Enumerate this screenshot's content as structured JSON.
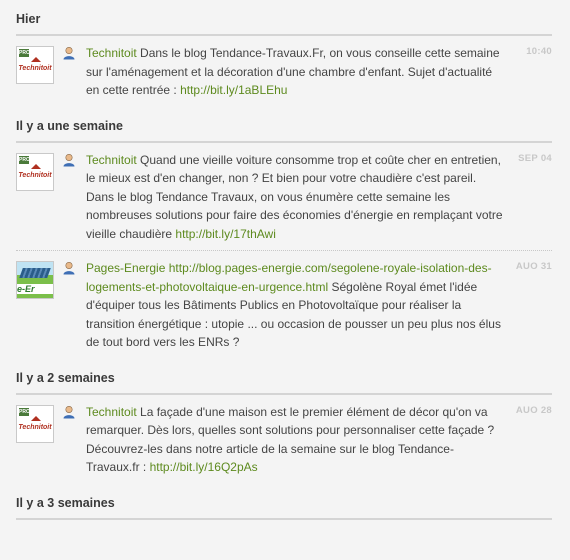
{
  "groups": [
    {
      "title": "Hier",
      "items": [
        {
          "avatar": "technitoit-logo",
          "author": "Technitoit",
          "text": " Dans le blog Tendance-Travaux.Fr, on vous conseille cette semaine sur l'aménagement et la décoration d'une chambre d'enfant. Sujet d'actualité en cette rentrée : ",
          "link": "http://bit.ly/1aBLEhu",
          "time": "10:40"
        }
      ]
    },
    {
      "title": "Il y a une semaine",
      "items": [
        {
          "avatar": "technitoit-logo",
          "author": "Technitoit",
          "text": " Quand une vieille voiture consomme trop et coûte cher en entretien, le mieux est d'en changer, non ? Et bien pour votre chaudière c'est pareil. Dans le blog Tendance Travaux, on vous énumère cette semaine les nombreuses solutions pour faire des économies d'énergie en remplaçant votre vieille chaudière ",
          "link": "http://bit.ly/17thAwi",
          "time": "SEP 04"
        },
        {
          "avatar": "pages-energie-logo",
          "author": "Pages-Energie",
          "text": " Ségolène Royal émet l'idée d'équiper tous les Bâtiments Publics en Photovoltaïque pour réaliser la transition énergétique : utopie ... ou occasion de pousser un peu plus nos élus de tout bord vers les ENRs ?",
          "link_before": "http://blog.pages-energie.com/segolene-royale-isolation-des-logements-et-photovoltaique-en-urgence.html",
          "time": "AUO 31"
        }
      ]
    },
    {
      "title": "Il y a 2 semaines",
      "items": [
        {
          "avatar": "technitoit-logo",
          "author": "Technitoit",
          "text": " La façade d'une maison est le premier élément de décor qu'on va remarquer. Dès lors, quelles sont solutions pour personnaliser cette façade ? Découvrez-les dans notre article de la semaine sur le blog Tendance-Travaux.fr : ",
          "link": "http://bit.ly/16Q2pAs",
          "time": "AUO 28"
        }
      ]
    },
    {
      "title": "Il y a 3 semaines",
      "items": []
    }
  ],
  "logo_text": {
    "pro": "PRO",
    "technitoit": "Technitoit",
    "pages_energie": "e-Er"
  },
  "colors": {
    "author": "#5d8a1e",
    "timestamp": "#c8c8c8",
    "background": "#f4f4f4"
  }
}
